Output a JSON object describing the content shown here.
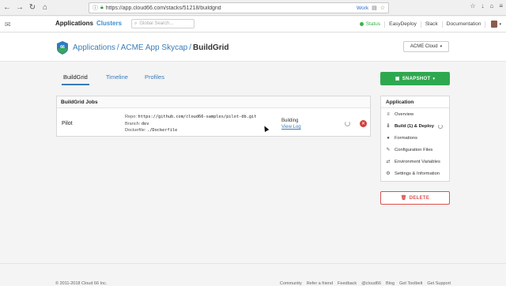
{
  "browser": {
    "back": "←",
    "forward": "→",
    "reload": "↻",
    "home": "⌂",
    "url": "https://app.cloud66.com/stacks/51218/buildgrid",
    "container": "Work",
    "right_icons": [
      "☆",
      "↓",
      "⌂",
      "≡"
    ]
  },
  "header": {
    "applications": "Applications",
    "clusters": "Clusters",
    "search_placeholder": "Global Search...",
    "status": "Status",
    "easydeploy": "EasyDeploy",
    "slack": "Slack",
    "documentation": "Documentation",
    "status_color": "#3bb34a"
  },
  "title": {
    "crumb_1": "Applications",
    "crumb_2": "ACME App",
    "crumb_3": "Skycap",
    "current": "BuildGrid",
    "stack_select": "ACME Cloud"
  },
  "tabs": [
    {
      "label": "BuildGrid"
    },
    {
      "label": "Timeline"
    },
    {
      "label": "Profiles"
    }
  ],
  "jobs": {
    "heading": "BuildGrid Jobs",
    "name": "Pilot",
    "repo_key": "Repo:",
    "repo_val": "https://github.com/cloud66-samples/pilot-db.git",
    "branch_key": "Branch:",
    "branch_val": "dev",
    "dockerfile_key": "Dockerfile:",
    "dockerfile_val": "./Dockerfile",
    "status": "Building",
    "view_log": "View Log"
  },
  "sidebar": {
    "snapshot": "SNAPSHOT",
    "heading": "Application",
    "items": [
      {
        "label": "Overview",
        "icon": "≡"
      },
      {
        "label": "Build (1) & Deploy",
        "icon": "⇩"
      },
      {
        "label": "Formations",
        "icon": "●"
      },
      {
        "label": "Configuration Files",
        "icon": "✎"
      },
      {
        "label": "Environment Variables",
        "icon": "⇄"
      },
      {
        "label": "Settings & Information",
        "icon": "⚙"
      }
    ],
    "delete": "DELETE"
  },
  "footer": {
    "copyright": "© 2011-2018 Cloud 66 Inc.",
    "links": [
      "Community",
      "Refer a friend",
      "Feedback",
      "@cloud66",
      "Blog",
      "Get Toolbelt",
      "Get Support"
    ]
  },
  "colors": {
    "accent": "#3a7db8",
    "success": "#2ea84f",
    "danger": "#d9534f"
  }
}
